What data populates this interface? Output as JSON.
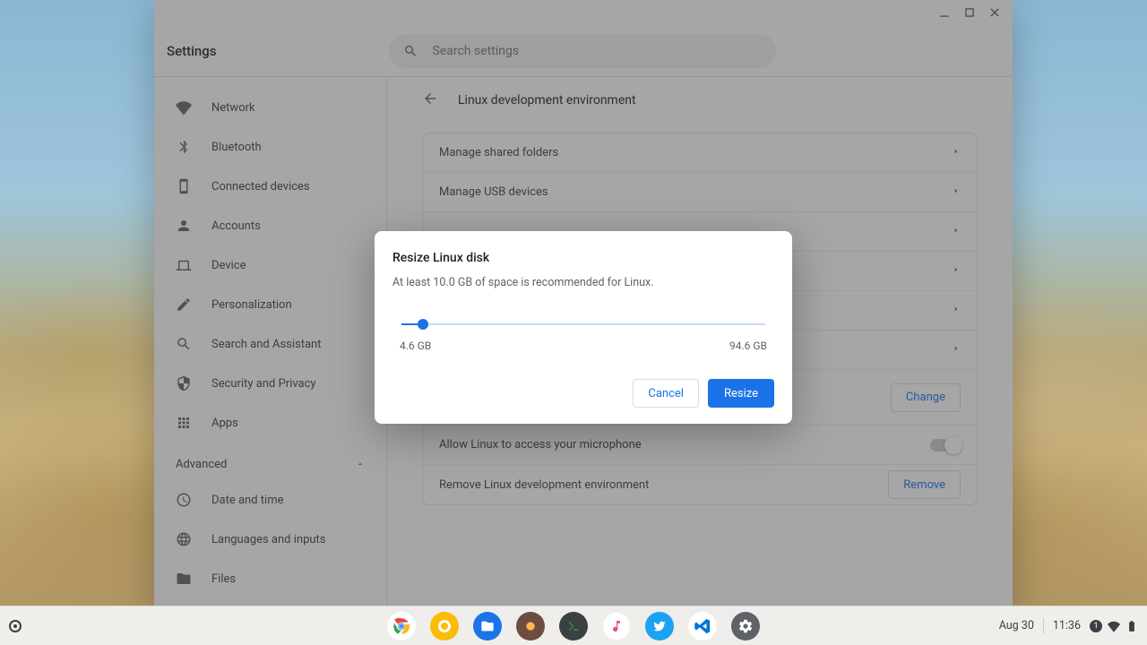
{
  "appTitle": "Settings",
  "search": {
    "placeholder": "Search settings"
  },
  "sidebar": {
    "items": [
      {
        "label": "Network"
      },
      {
        "label": "Bluetooth"
      },
      {
        "label": "Connected devices"
      },
      {
        "label": "Accounts"
      },
      {
        "label": "Device"
      },
      {
        "label": "Personalization"
      },
      {
        "label": "Search and Assistant"
      },
      {
        "label": "Security and Privacy"
      },
      {
        "label": "Apps"
      }
    ],
    "advancedLabel": "Advanced",
    "advanced": [
      {
        "label": "Date and time"
      },
      {
        "label": "Languages and inputs"
      },
      {
        "label": "Files"
      }
    ]
  },
  "pageTitle": "Linux development environment",
  "rows": {
    "sharedFolders": "Manage shared folders",
    "usb": "Manage USB devices",
    "diskChange": "Change",
    "mic": "Allow Linux to access your microphone",
    "remove": "Remove Linux development environment",
    "removeBtn": "Remove"
  },
  "dialog": {
    "title": "Resize Linux disk",
    "desc": "At least 10.0 GB of space is recommended for Linux.",
    "min": "4.6 GB",
    "max": "94.6 GB",
    "cancel": "Cancel",
    "confirm": "Resize"
  },
  "shelf": {
    "date": "Aug 30",
    "time": "11:36",
    "notifCount": "1"
  }
}
